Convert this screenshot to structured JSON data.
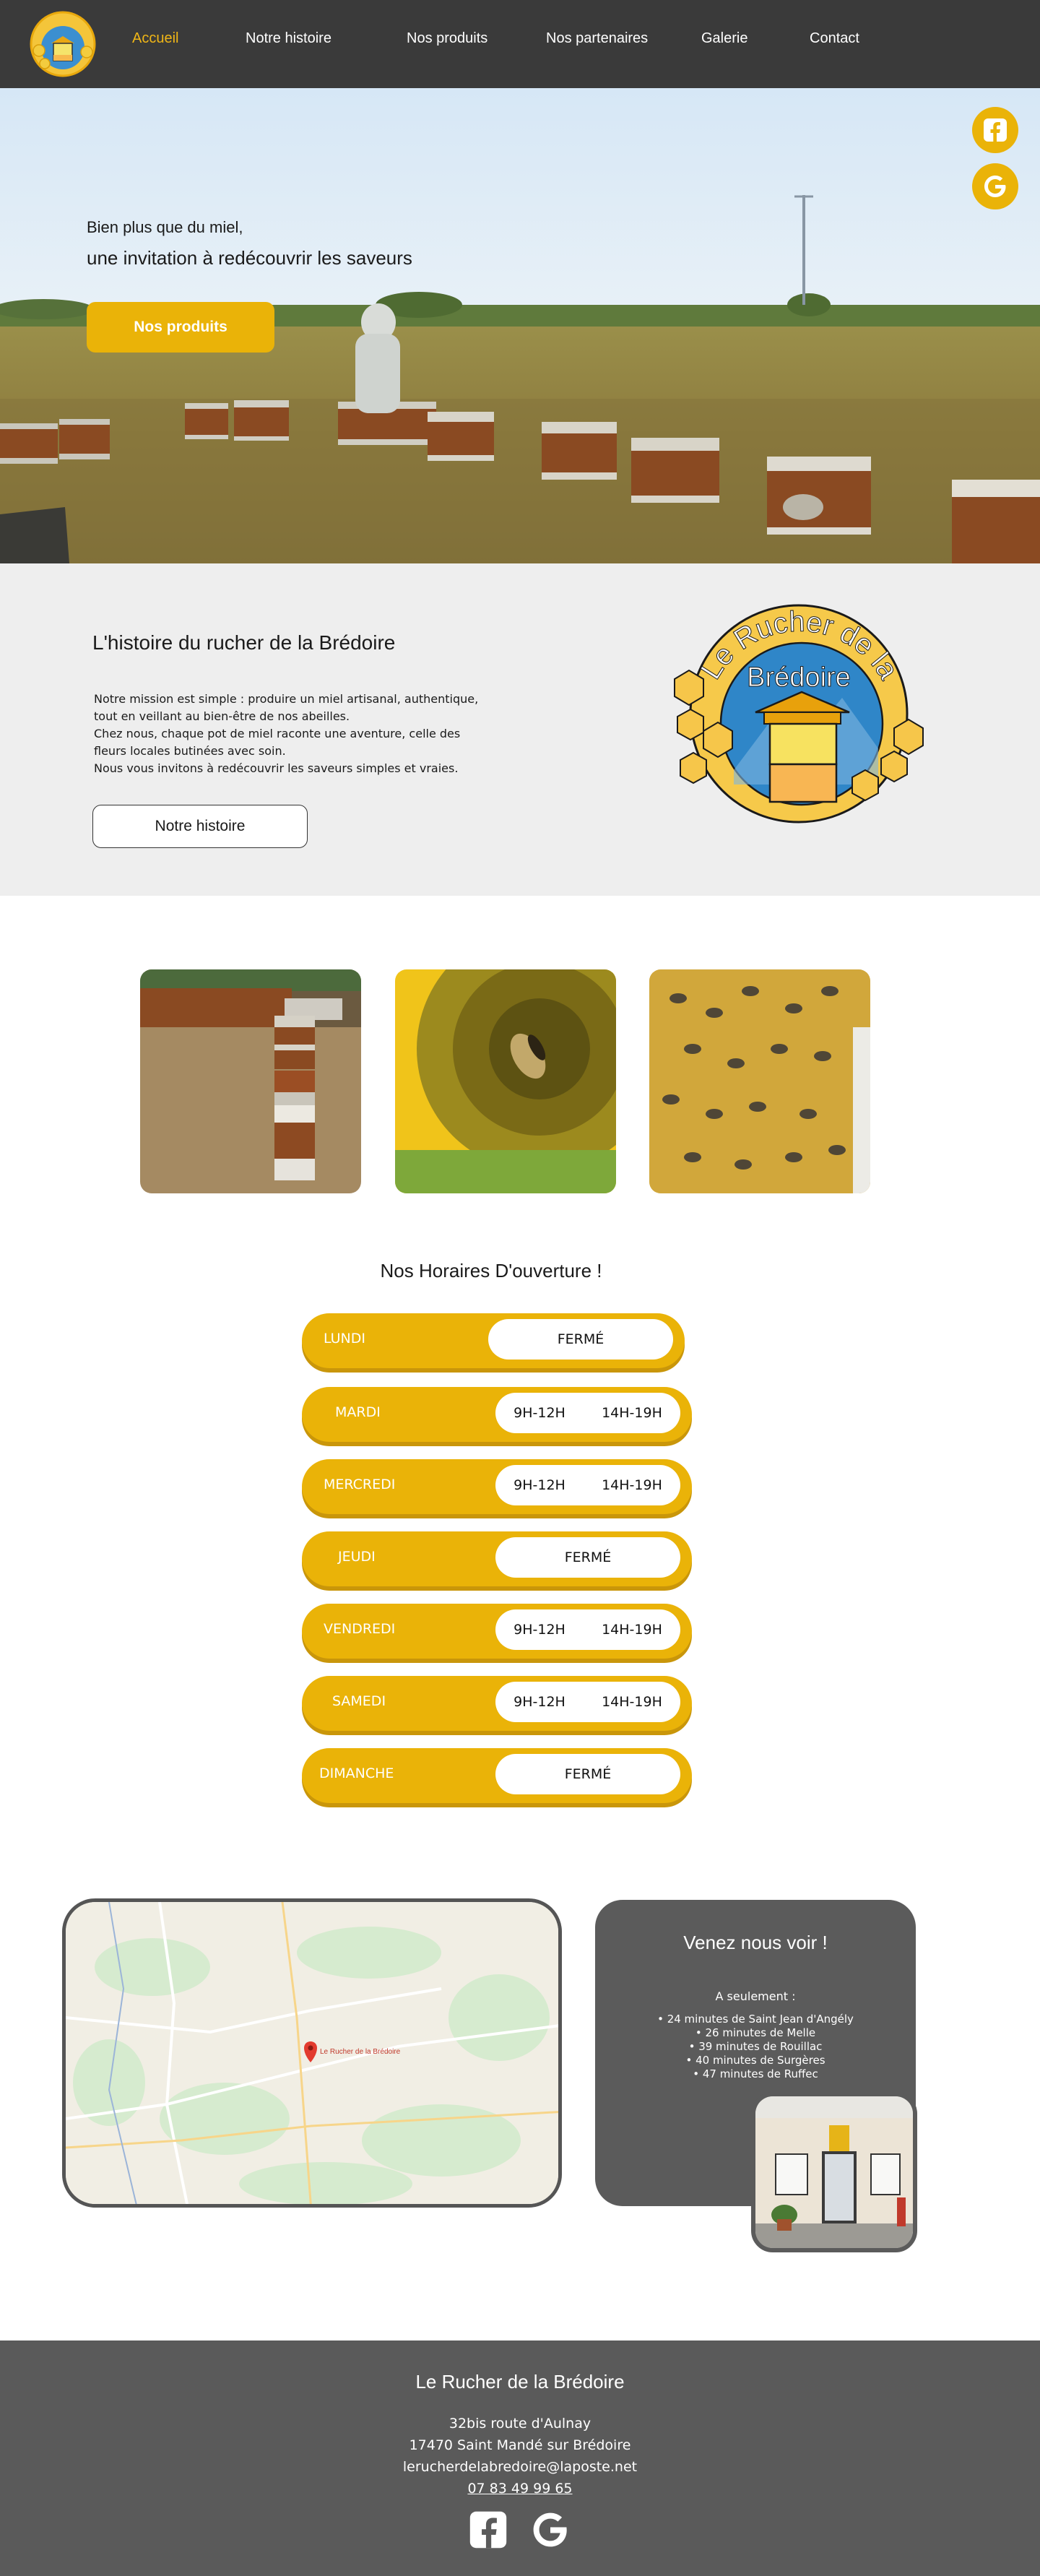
{
  "nav": {
    "items": [
      {
        "label": "Accueil",
        "active": true
      },
      {
        "label": "Notre histoire"
      },
      {
        "label": "Nos produits"
      },
      {
        "label": "Nos partenaires"
      },
      {
        "label": "Galerie"
      },
      {
        "label": "Contact"
      }
    ]
  },
  "logo": {
    "line1": "Le Rucher de la",
    "line2": "Brédoire"
  },
  "hero": {
    "subtitle": "Bien plus que du miel,",
    "title": "une invitation à redécouvrir les saveurs",
    "button": "Nos produits",
    "social_icons": [
      "facebook-icon",
      "google-icon"
    ]
  },
  "story": {
    "title": "L'histoire du rucher de la Brédoire",
    "lines": [
      "Notre mission est simple : produire un miel artisanal, authentique,",
      "tout en veillant au bien-être de nos abeilles.",
      "Chez nous, chaque pot de miel raconte une aventure, celle des",
      "fleurs locales butinées avec soin.",
      "Nous vous invitons à redécouvrir les saveurs simples et vraies."
    ],
    "button": "Notre histoire"
  },
  "hours": {
    "title": "Nos Horaires D'ouverture !",
    "days": [
      {
        "day": "LUNDI",
        "closed": "FERMÉ"
      },
      {
        "day": "MARDI",
        "am": "9H-12H",
        "pm": "14H-19H"
      },
      {
        "day": "MERCREDI",
        "am": "9H-12H",
        "pm": "14H-19H"
      },
      {
        "day": "JEUDI",
        "closed": "FERMÉ"
      },
      {
        "day": "VENDREDI",
        "am": "9H-12H",
        "pm": "14H-19H"
      },
      {
        "day": "SAMEDI",
        "am": "9H-12H",
        "pm": "14H-19H"
      },
      {
        "day": "DIMANCHE",
        "closed": "FERMÉ"
      }
    ]
  },
  "visit": {
    "title": "Venez nous voir !",
    "only": "A seulement :",
    "distances": [
      "24 minutes de Saint Jean d'Angély",
      "26 minutes de Melle",
      "39 minutes de Rouillac",
      "40 minutes de Surgères",
      "47 minutes de Ruffec"
    ],
    "map_marker_label": "Le Rucher de la Brédoire"
  },
  "footer": {
    "title": "Le Rucher de la Brédoire",
    "address1": "32bis route d'Aulnay",
    "address2": "17470 Saint Mandé sur Brédoire",
    "email": "lerucherdelabredoire@laposte.net",
    "phone": "07 83 49 99 65"
  },
  "colors": {
    "nav_bg": "#3a3a3a",
    "accent": "#eab308",
    "story_bg": "#eeeeee",
    "footer_bg": "#5a5a5a",
    "card_bg": "#5b5b5b"
  }
}
